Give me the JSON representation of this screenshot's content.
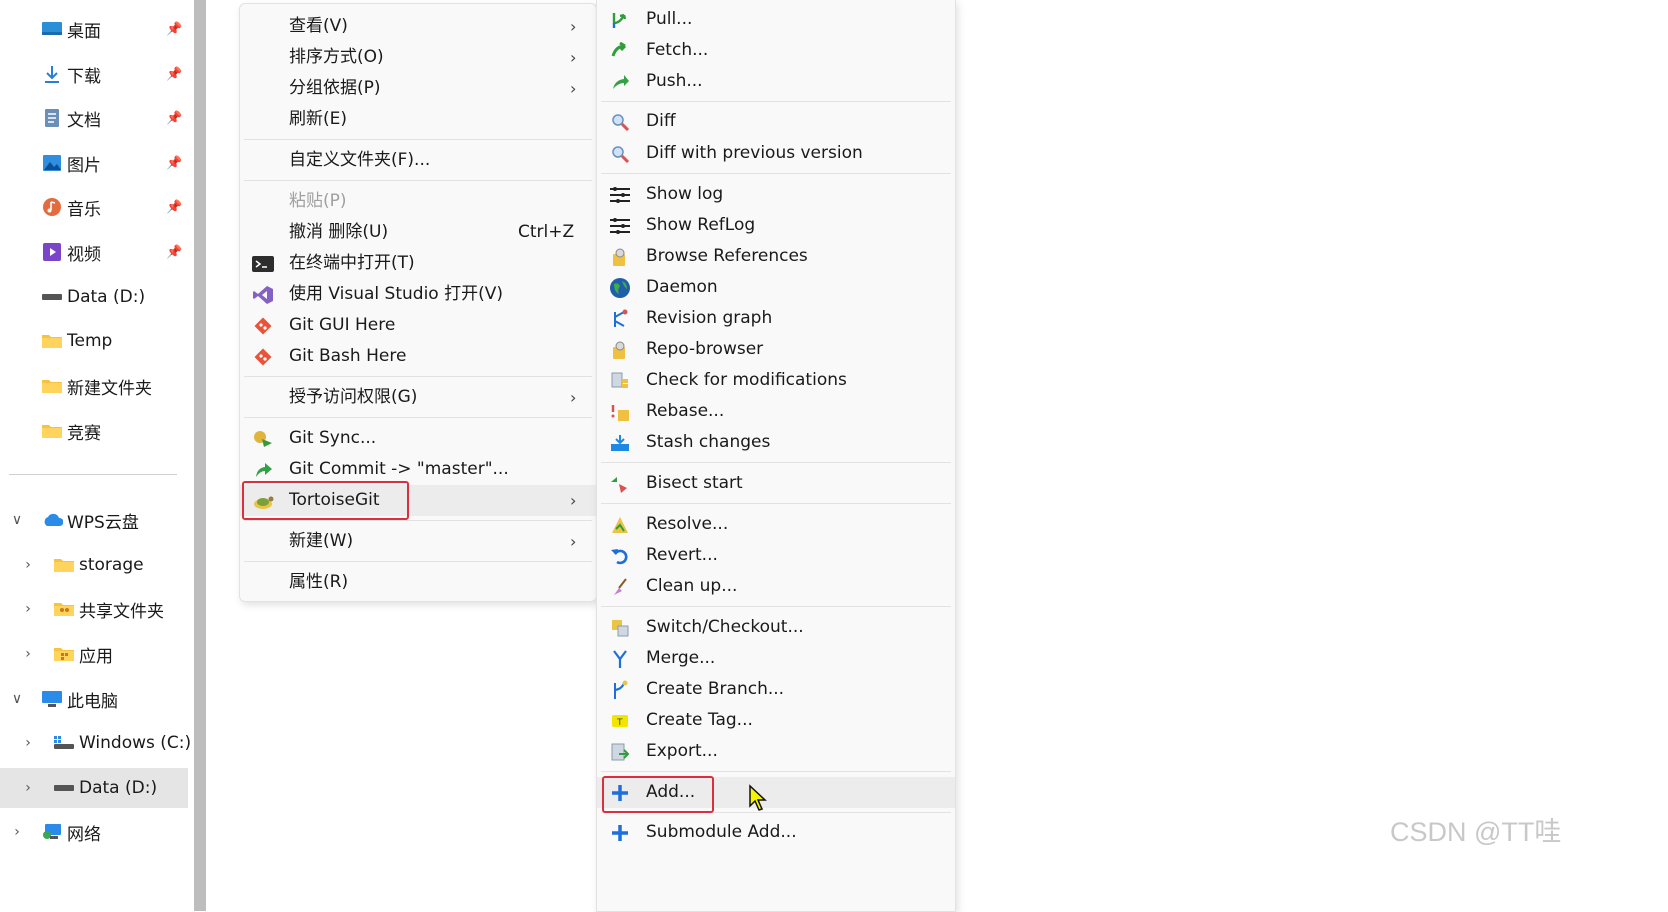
{
  "nav": {
    "quick_access": [
      {
        "label": "桌面",
        "icon": "desktop-icon"
      },
      {
        "label": "下载",
        "icon": "download-icon"
      },
      {
        "label": "文档",
        "icon": "document-icon"
      },
      {
        "label": "图片",
        "icon": "picture-icon"
      },
      {
        "label": "音乐",
        "icon": "music-icon"
      },
      {
        "label": "视频",
        "icon": "video-icon"
      },
      {
        "label": "Data (D:)",
        "icon": "drive-icon"
      },
      {
        "label": "Temp",
        "icon": "folder-icon"
      },
      {
        "label": "新建文件夹",
        "icon": "folder-icon"
      },
      {
        "label": "竞赛",
        "icon": "folder-icon"
      }
    ],
    "tree": [
      {
        "label": "WPS云盘",
        "icon": "cloud-icon",
        "chevron": "∨"
      },
      {
        "label": "storage",
        "icon": "folder-icon",
        "chevron": "›"
      },
      {
        "label": "共享文件夹",
        "icon": "shared-folder-icon",
        "chevron": "›"
      },
      {
        "label": "应用",
        "icon": "app-folder-icon",
        "chevron": "›"
      },
      {
        "label": "此电脑",
        "icon": "computer-icon",
        "chevron": "∨"
      },
      {
        "label": "Windows (C:)",
        "icon": "windows-drive-icon",
        "chevron": "›"
      },
      {
        "label": "Data (D:)",
        "icon": "drive-icon",
        "chevron": "›"
      },
      {
        "label": "网络",
        "icon": "network-icon",
        "chevron": "›"
      }
    ]
  },
  "menu1": {
    "items": [
      {
        "label": "查看(V)",
        "arrow": "›"
      },
      {
        "label": "排序方式(O)",
        "arrow": "›"
      },
      {
        "label": "分组依据(P)",
        "arrow": "›"
      },
      {
        "label": "刷新(E)"
      },
      {
        "label": "自定义文件夹(F)..."
      },
      {
        "label": "粘贴(P)"
      },
      {
        "label": "撤消 删除(U)",
        "shortcut": "Ctrl+Z"
      },
      {
        "label": "在终端中打开(T)",
        "icon": "terminal-icon"
      },
      {
        "label": "使用 Visual Studio 打开(V)",
        "icon": "visual-studio-icon"
      },
      {
        "label": "Git GUI Here",
        "icon": "git-icon"
      },
      {
        "label": "Git Bash Here",
        "icon": "git-icon"
      },
      {
        "label": "授予访问权限(G)",
        "arrow": "›"
      },
      {
        "label": "Git Sync...",
        "icon": "git-sync-icon"
      },
      {
        "label": "Git Commit -> \"master\"...",
        "icon": "git-commit-icon"
      },
      {
        "label": "TortoiseGit",
        "icon": "tortoisegit-icon",
        "arrow": "›"
      },
      {
        "label": "新建(W)",
        "arrow": "›"
      },
      {
        "label": "属性(R)"
      }
    ]
  },
  "menu2": {
    "items": [
      {
        "label": "Pull...",
        "icon": "pull-icon"
      },
      {
        "label": "Fetch...",
        "icon": "fetch-icon"
      },
      {
        "label": "Push...",
        "icon": "push-icon"
      },
      {
        "label": "Diff",
        "icon": "diff-icon"
      },
      {
        "label": "Diff with previous version",
        "icon": "diff-icon"
      },
      {
        "label": "Show log",
        "icon": "log-icon"
      },
      {
        "label": "Show RefLog",
        "icon": "log-icon"
      },
      {
        "label": "Browse References",
        "icon": "references-icon"
      },
      {
        "label": "Daemon",
        "icon": "globe-icon"
      },
      {
        "label": "Revision graph",
        "icon": "revision-graph-icon"
      },
      {
        "label": "Repo-browser",
        "icon": "repo-browser-icon"
      },
      {
        "label": "Check for modifications",
        "icon": "check-modifications-icon"
      },
      {
        "label": "Rebase...",
        "icon": "rebase-icon"
      },
      {
        "label": "Stash changes",
        "icon": "stash-icon"
      },
      {
        "label": "Bisect start",
        "icon": "bisect-icon"
      },
      {
        "label": "Resolve...",
        "icon": "resolve-icon"
      },
      {
        "label": "Revert...",
        "icon": "revert-icon"
      },
      {
        "label": "Clean up...",
        "icon": "cleanup-icon"
      },
      {
        "label": "Switch/Checkout...",
        "icon": "switch-icon"
      },
      {
        "label": "Merge...",
        "icon": "merge-icon"
      },
      {
        "label": "Create Branch...",
        "icon": "branch-icon"
      },
      {
        "label": "Create Tag...",
        "icon": "tag-icon"
      },
      {
        "label": "Export...",
        "icon": "export-icon"
      },
      {
        "label": "Add...",
        "icon": "plus-icon"
      },
      {
        "label": "Submodule Add...",
        "icon": "plus-icon"
      }
    ]
  },
  "colors": {
    "highlight_box": "#d9303f",
    "menu_bg": "#f9f9f9",
    "accent_blue": "#1e6fd9",
    "git_orange": "#e8543a"
  },
  "watermark": "CSDN @TT哇"
}
